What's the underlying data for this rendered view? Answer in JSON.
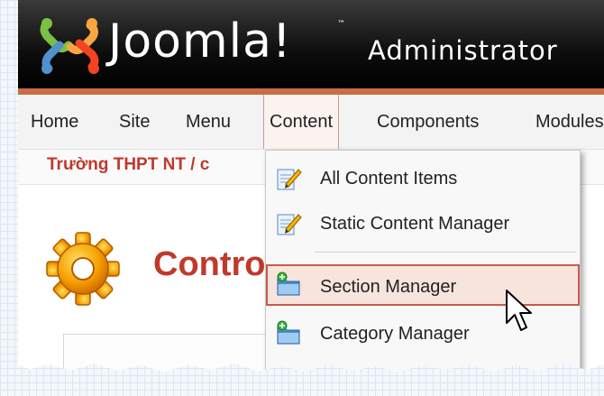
{
  "header": {
    "logo_text": "Joomla!",
    "logo_tm": "™",
    "admin_text": "Administrator"
  },
  "menu": [
    {
      "label": "Home"
    },
    {
      "label": "Site"
    },
    {
      "label": "Menu"
    },
    {
      "label": "Content",
      "active": true
    },
    {
      "label": "Components"
    },
    {
      "label": "Modules"
    }
  ],
  "breadcrumb": "Trường THPT NT / c",
  "page": {
    "title": "Control Panel"
  },
  "dropdown": {
    "items": [
      {
        "label": "All Content Items",
        "icon": "edit-document-icon"
      },
      {
        "label": "Static Content Manager",
        "icon": "edit-document-icon"
      },
      {
        "label": "Section Manager",
        "icon": "folder-add-icon",
        "highlighted": true
      },
      {
        "label": "Category Manager",
        "icon": "folder-add-icon"
      }
    ]
  },
  "colors": {
    "accent": "#c0392b",
    "header_bg": "#000000",
    "header_stripe": "#c86e44",
    "highlight_bg": "#f7e4dc",
    "highlight_border": "#c85a4a"
  }
}
